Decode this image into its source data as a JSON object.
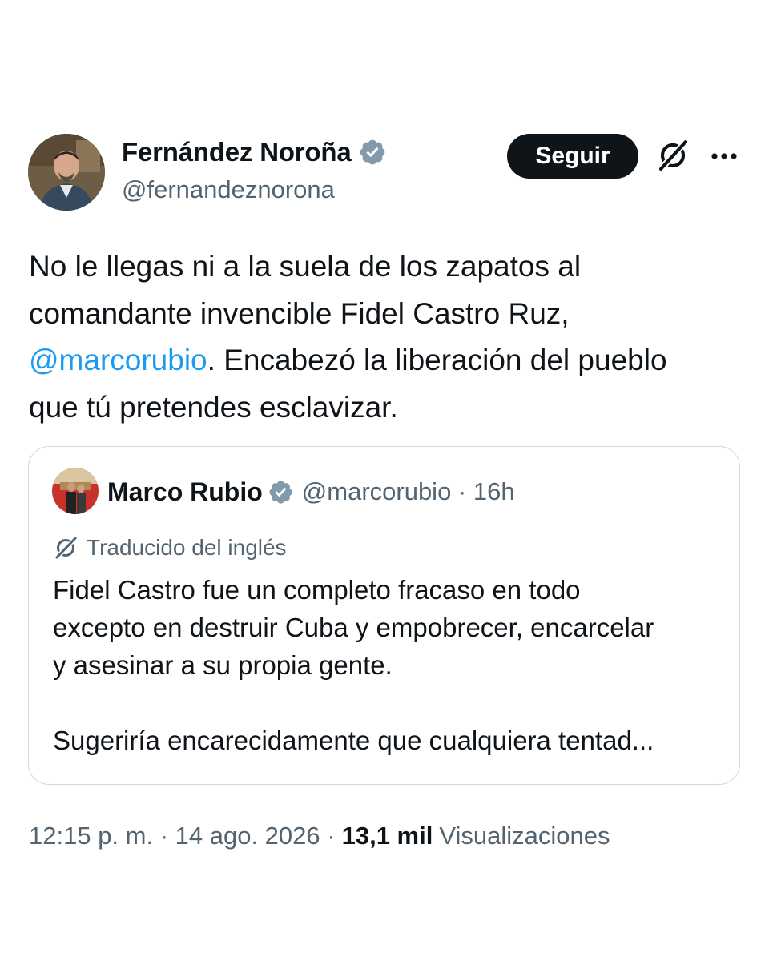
{
  "author": {
    "name": "Fernández Noroña",
    "handle": "@fernandeznorona",
    "verified_icon": "verified-badge-icon"
  },
  "actions": {
    "follow_label": "Seguir",
    "grok_icon": "grok-icon",
    "more_icon": "more-options-icon"
  },
  "tweet": {
    "line1": "No le llegas ni a la suela de los zapatos al",
    "line2": "comandante invencible Fidel Castro Ruz,",
    "mention": "@marcorubio",
    "line3_rest": ". Encabezó la liberación del pueblo",
    "line4": "que tú pretendes esclavizar."
  },
  "quote": {
    "name": "Marco Rubio",
    "handle_time": "@marcorubio · 16h",
    "translated_label": "Traducido del inglés",
    "line1": "Fidel Castro fue un completo fracaso en todo",
    "line2": "excepto en destruir Cuba y empobrecer, encarcelar",
    "line3": "y asesinar a su propia gente.",
    "line4": "Sugeriría encarecidamente que cualquiera tentad..."
  },
  "footer": {
    "time_date": "12:15 p. m. · 14 ago. 2026 ·",
    "views_count": "13,1 mil",
    "views_label": "Visualizaciones"
  },
  "colors": {
    "text": "#0f1419",
    "secondary": "#536471",
    "mention": "#1d9bf0",
    "verified": "#829aab",
    "border": "#cfd9de",
    "button": "#0f1419"
  }
}
